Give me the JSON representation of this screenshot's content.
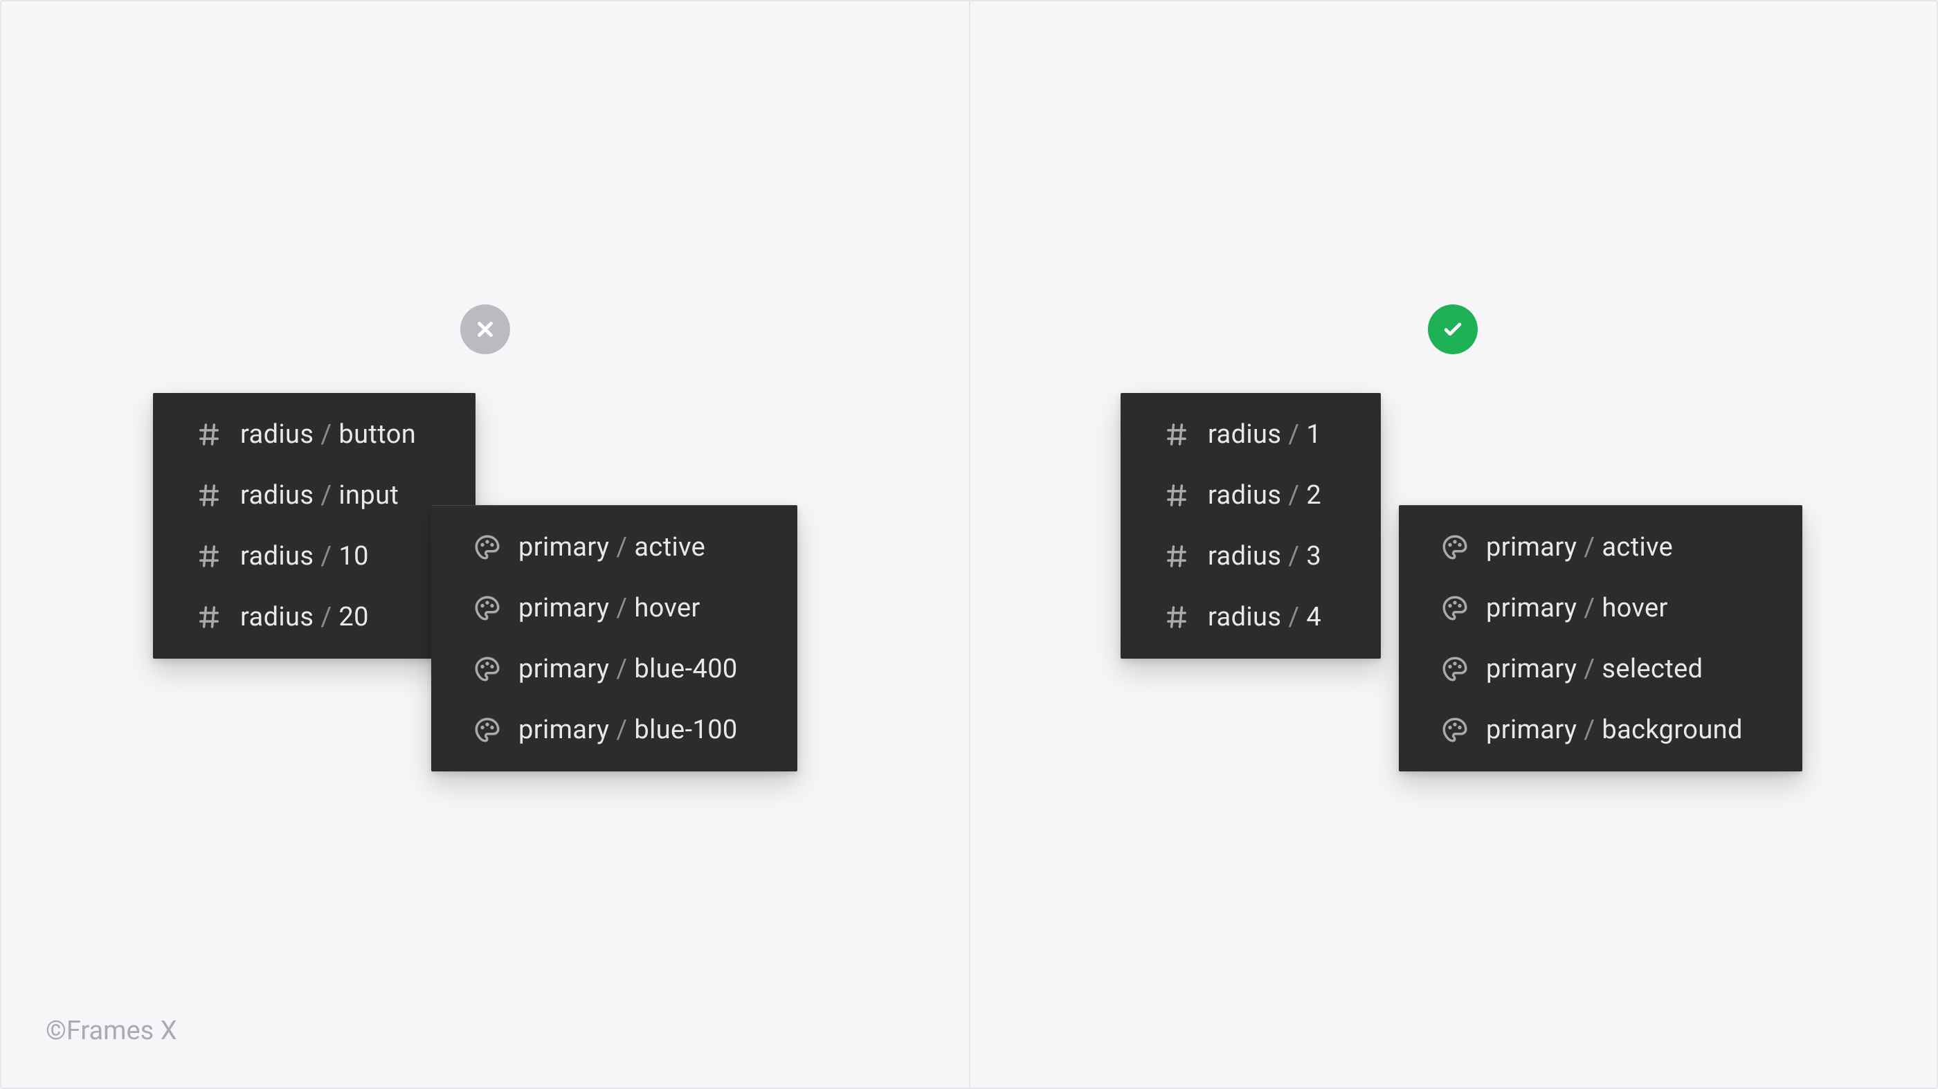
{
  "credit": "©Frames X",
  "left": {
    "status": "bad",
    "radius": [
      {
        "prefix": "radius",
        "value": "button"
      },
      {
        "prefix": "radius",
        "value": "input"
      },
      {
        "prefix": "radius",
        "value": "10"
      },
      {
        "prefix": "radius",
        "value": "20"
      }
    ],
    "color": [
      {
        "prefix": "primary",
        "value": "active"
      },
      {
        "prefix": "primary",
        "value": "hover"
      },
      {
        "prefix": "primary",
        "value": "blue-400"
      },
      {
        "prefix": "primary",
        "value": "blue-100"
      }
    ]
  },
  "right": {
    "status": "good",
    "radius": [
      {
        "prefix": "radius",
        "value": "1"
      },
      {
        "prefix": "radius",
        "value": "2"
      },
      {
        "prefix": "radius",
        "value": "3"
      },
      {
        "prefix": "radius",
        "value": "4"
      }
    ],
    "color": [
      {
        "prefix": "primary",
        "value": "active"
      },
      {
        "prefix": "primary",
        "value": "hover"
      },
      {
        "prefix": "primary",
        "value": "selected"
      },
      {
        "prefix": "primary",
        "value": "background"
      }
    ]
  }
}
